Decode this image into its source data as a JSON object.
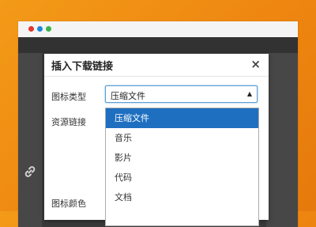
{
  "window": {
    "controls": [
      "close",
      "minimize",
      "maximize"
    ]
  },
  "dialog": {
    "title": "插入下载链接",
    "close_symbol": "×",
    "fields": {
      "icon_type_label": "图标类型",
      "resource_link_label": "资源链接",
      "icon_color_label": "图标颜色"
    },
    "select": {
      "value": "压缩文件",
      "arrow": "▲",
      "options": [
        "压缩文件",
        "音乐",
        "影片",
        "代码",
        "文档"
      ],
      "selected_index": 0
    }
  },
  "colors": {
    "background": "#f08c14",
    "selected_option": "#1e6fc0",
    "focus_border": "#5b9dd9"
  },
  "icons": {
    "page_link": "link-icon"
  }
}
